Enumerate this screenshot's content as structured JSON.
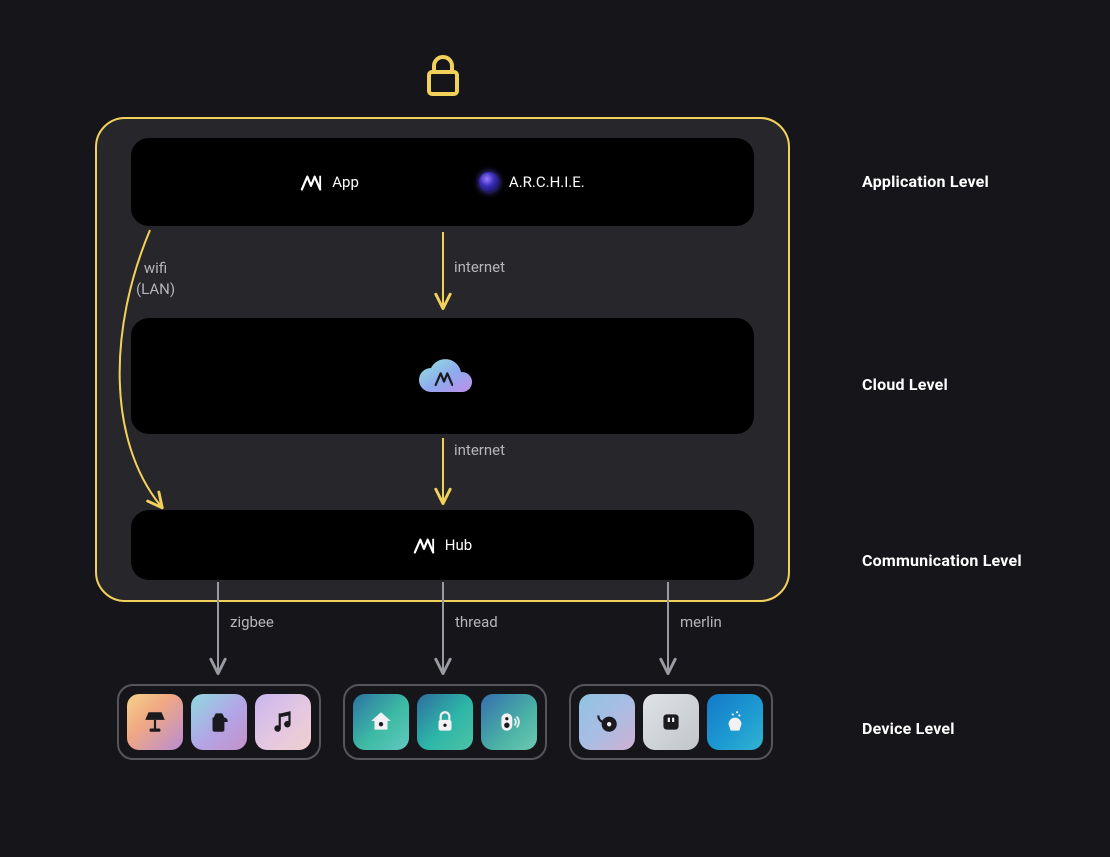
{
  "secure_icon": "lock",
  "levels": {
    "application": {
      "label": "Application Level"
    },
    "cloud": {
      "label": "Cloud Level"
    },
    "comm": {
      "label": "Communication Level"
    },
    "device": {
      "label": "Device Level"
    }
  },
  "boxes": {
    "application": {
      "items": [
        {
          "icon": "m-logo",
          "label": "App"
        },
        {
          "icon": "archie-orb",
          "label": "A.R.C.H.I.E."
        }
      ]
    },
    "cloud": {
      "icon": "m-cloud"
    },
    "communication": {
      "icon": "m-logo",
      "label": "Hub"
    }
  },
  "connections": {
    "app_to_cloud": {
      "label": "internet"
    },
    "cloud_to_hub": {
      "label": "internet"
    },
    "app_to_hub_lan": {
      "label_line1": "wifi",
      "label_line2": "(LAN)"
    },
    "hub_to_zigbee": {
      "label": "zigbee"
    },
    "hub_to_thread": {
      "label": "thread"
    },
    "hub_to_merlin": {
      "label": "merlin"
    }
  },
  "device_groups": [
    {
      "protocol": "zigbee",
      "devices": [
        "lamp",
        "kettle",
        "music"
      ]
    },
    {
      "protocol": "thread",
      "devices": [
        "thermostat",
        "lock",
        "sensor"
      ]
    },
    {
      "protocol": "merlin",
      "devices": [
        "vacuum",
        "socket",
        "diffuser"
      ]
    }
  ]
}
